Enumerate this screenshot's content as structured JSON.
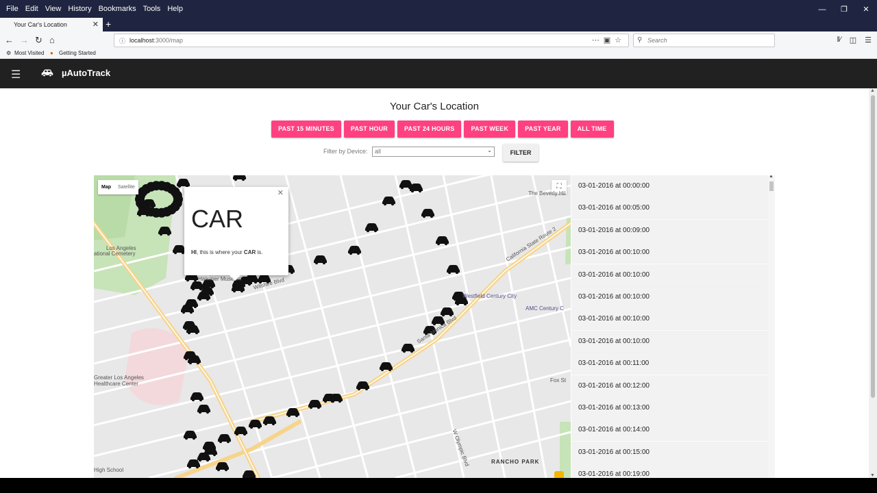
{
  "browser": {
    "menu": [
      "File",
      "Edit",
      "View",
      "History",
      "Bookmarks",
      "Tools",
      "Help"
    ],
    "tab_title": "Your Car's Location",
    "url_host": "localhost",
    "url_rest": ":3000/map",
    "search_placeholder": "Search",
    "bookmarks": [
      "Most Visited",
      "Getting Started"
    ]
  },
  "app": {
    "brand": "µAutoTrack"
  },
  "page": {
    "title": "Your Car's Location",
    "range_buttons": [
      "PAST 15 MINUTES",
      "PAST HOUR",
      "PAST 24 HOURS",
      "PAST WEEK",
      "PAST YEAR",
      "ALL TIME"
    ],
    "filter_label": "Filter by Device:",
    "device_value": "all",
    "filter_button": "FILTER"
  },
  "map": {
    "type_options": [
      "Map",
      "Satellite"
    ],
    "info_title": "CAR",
    "info_hi": "HI",
    "info_mid": ", this is where your ",
    "info_car": "CAR",
    "info_end": " is.",
    "labels": {
      "los_angeles": "Los Angeles",
      "cemetery": "ational Cemetery",
      "hammer": "Hammer Museum",
      "westfield": "Westfield Century City",
      "amc": "AMC Century C",
      "beverly": "The Beverly Hil",
      "hospital1": "Greater Los Angeles",
      "hospital2": "Healthcare Center",
      "rancho": "RANCHO PARK",
      "highschool": "High School",
      "fox": "Fox St",
      "state_route": "California State Route 2",
      "santa_monica": "Santa Monica Blvd",
      "wilshire": "Wilshire Blvd",
      "olympic": "W Olympic Blvd"
    }
  },
  "locations": [
    "03-01-2016 at 00:00:00",
    "03-01-2016 at 00:05:00",
    "03-01-2016 at 00:09:00",
    "03-01-2016 at 00:10:00",
    "03-01-2016 at 00:10:00",
    "03-01-2016 at 00:10:00",
    "03-01-2016 at 00:10:00",
    "03-01-2016 at 00:10:00",
    "03-01-2016 at 00:11:00",
    "03-01-2016 at 00:12:00",
    "03-01-2016 at 00:13:00",
    "03-01-2016 at 00:14:00",
    "03-01-2016 at 00:15:00",
    "03-01-2016 at 00:19:00"
  ],
  "colors": {
    "accent": "#ff4081",
    "appbar": "#212121",
    "browser_frame": "#1f2540"
  }
}
